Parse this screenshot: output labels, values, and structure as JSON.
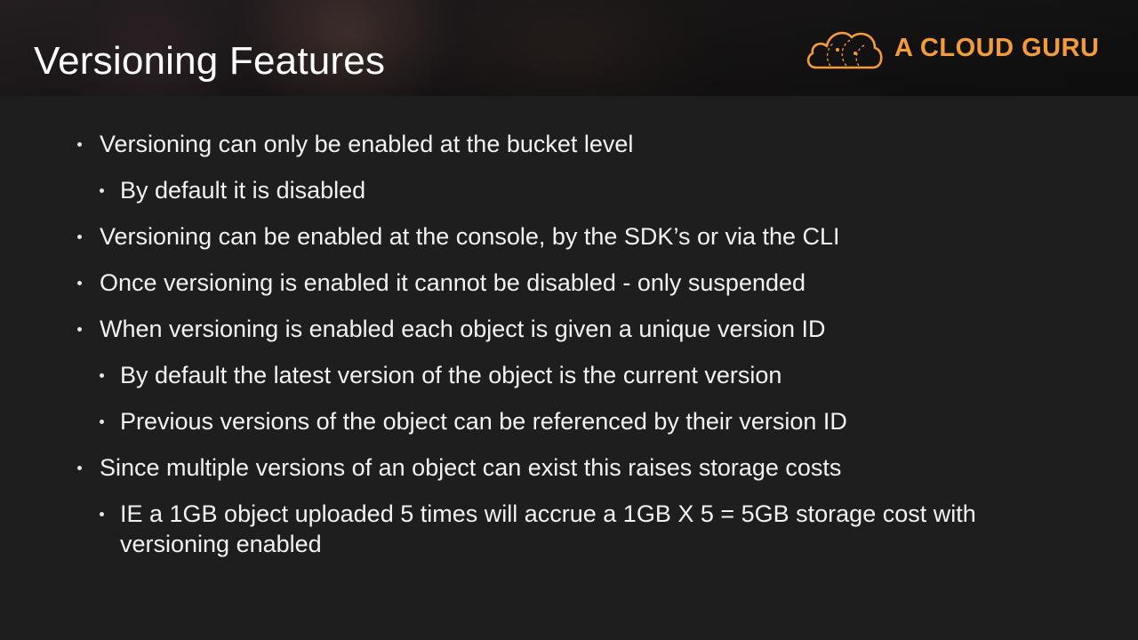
{
  "slide": {
    "title": "Versioning Features",
    "logo": {
      "text": "A CLOUD GURU",
      "icon": "cloud-logo-icon",
      "color": "#f49b3a"
    },
    "bullets": [
      {
        "level": 1,
        "text": "Versioning can only be enabled at the bucket level"
      },
      {
        "level": 2,
        "text": "By default it is disabled"
      },
      {
        "level": 1,
        "text": "Versioning can be enabled at the console, by the SDK’s or via the CLI"
      },
      {
        "level": 1,
        "text": "Once versioning is enabled it cannot be disabled - only suspended"
      },
      {
        "level": 1,
        "text": "When versioning is enabled each object is given a unique version ID"
      },
      {
        "level": 2,
        "text": "By default the latest version of the object is the current version"
      },
      {
        "level": 2,
        "text": "Previous versions of the object can be referenced by their version ID"
      },
      {
        "level": 1,
        "text": "Since multiple versions of an object can exist this raises storage costs"
      },
      {
        "level": 2,
        "text": "IE a 1GB object uploaded 5 times will accrue a 1GB X 5 = 5GB storage cost with versioning enabled"
      }
    ]
  }
}
